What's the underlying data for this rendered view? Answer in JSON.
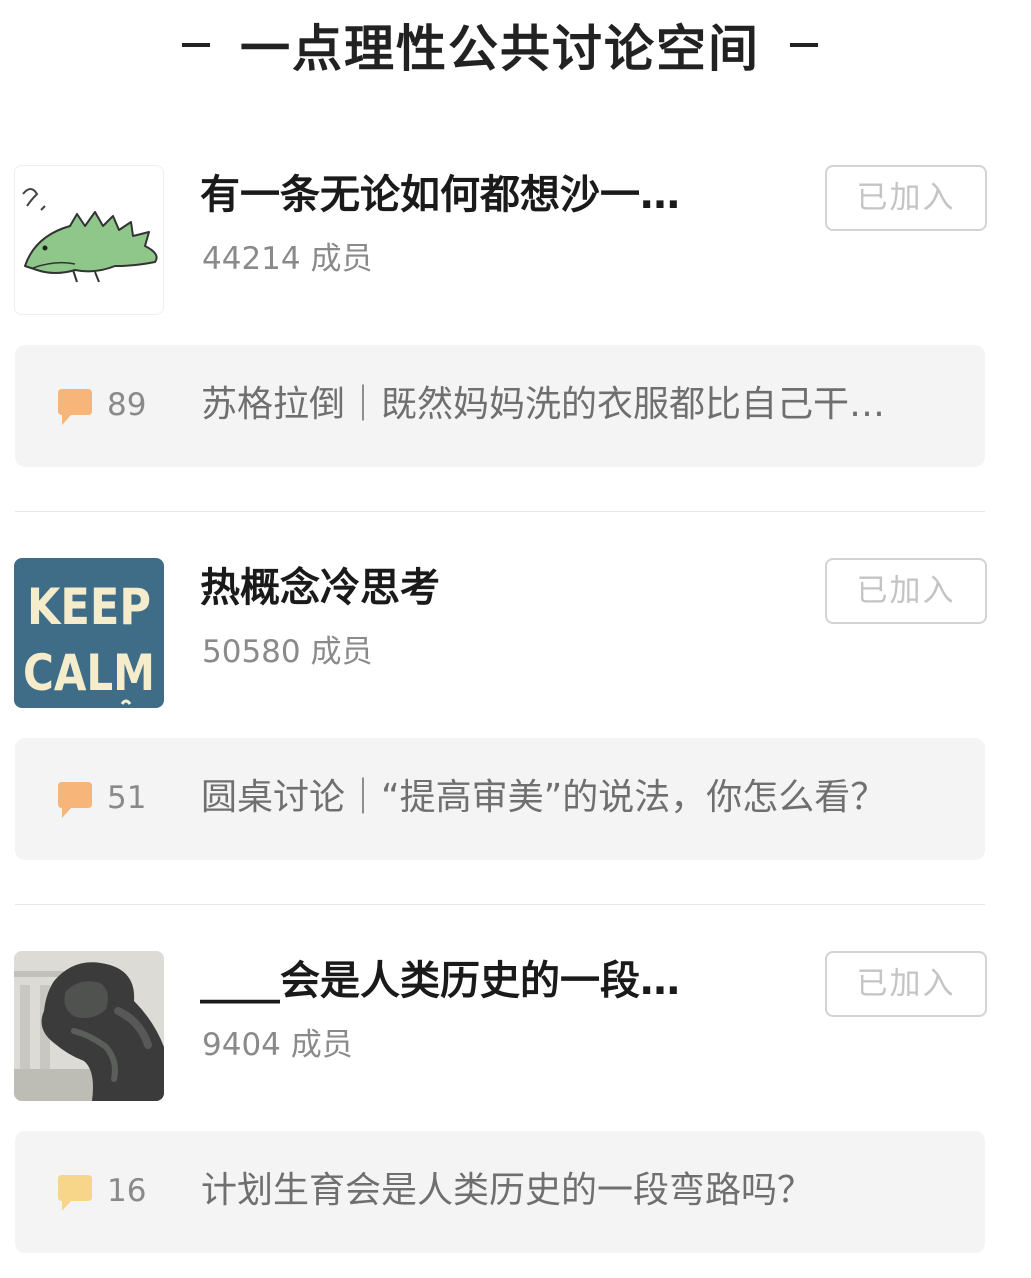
{
  "section": {
    "title": "一点理性公共讨论空间"
  },
  "groups": [
    {
      "name": "有一条无论如何都想沙一…",
      "member_count": "44214",
      "member_suffix": "成员",
      "join_label": "已加入",
      "post": {
        "comment_count": "89",
        "title": "苏格拉倒｜既然妈妈洗的衣服都比自己干…"
      }
    },
    {
      "name": "热概念冷思考",
      "member_count": "50580",
      "member_suffix": "成员",
      "join_label": "已加入",
      "avatar_text": [
        "KEEP",
        "CALM"
      ],
      "post": {
        "comment_count": "51",
        "title": "圆桌讨论｜“提高审美”的说法，你怎么看？"
      }
    },
    {
      "name": "____会是人类历史的一段…",
      "member_count": "9404",
      "member_suffix": "成员",
      "join_label": "已加入",
      "post": {
        "comment_count": "16",
        "title": "计划生育会是人类历史的一段弯路吗？"
      }
    }
  ],
  "colors": {
    "bubble_orange": "#f7b57a",
    "bubble_yellow": "#f7d589",
    "keep_calm_bg": "#3f6c86",
    "keep_calm_text": "#f4eccb"
  },
  "icons": {
    "comment": "speech-bubble-icon"
  }
}
